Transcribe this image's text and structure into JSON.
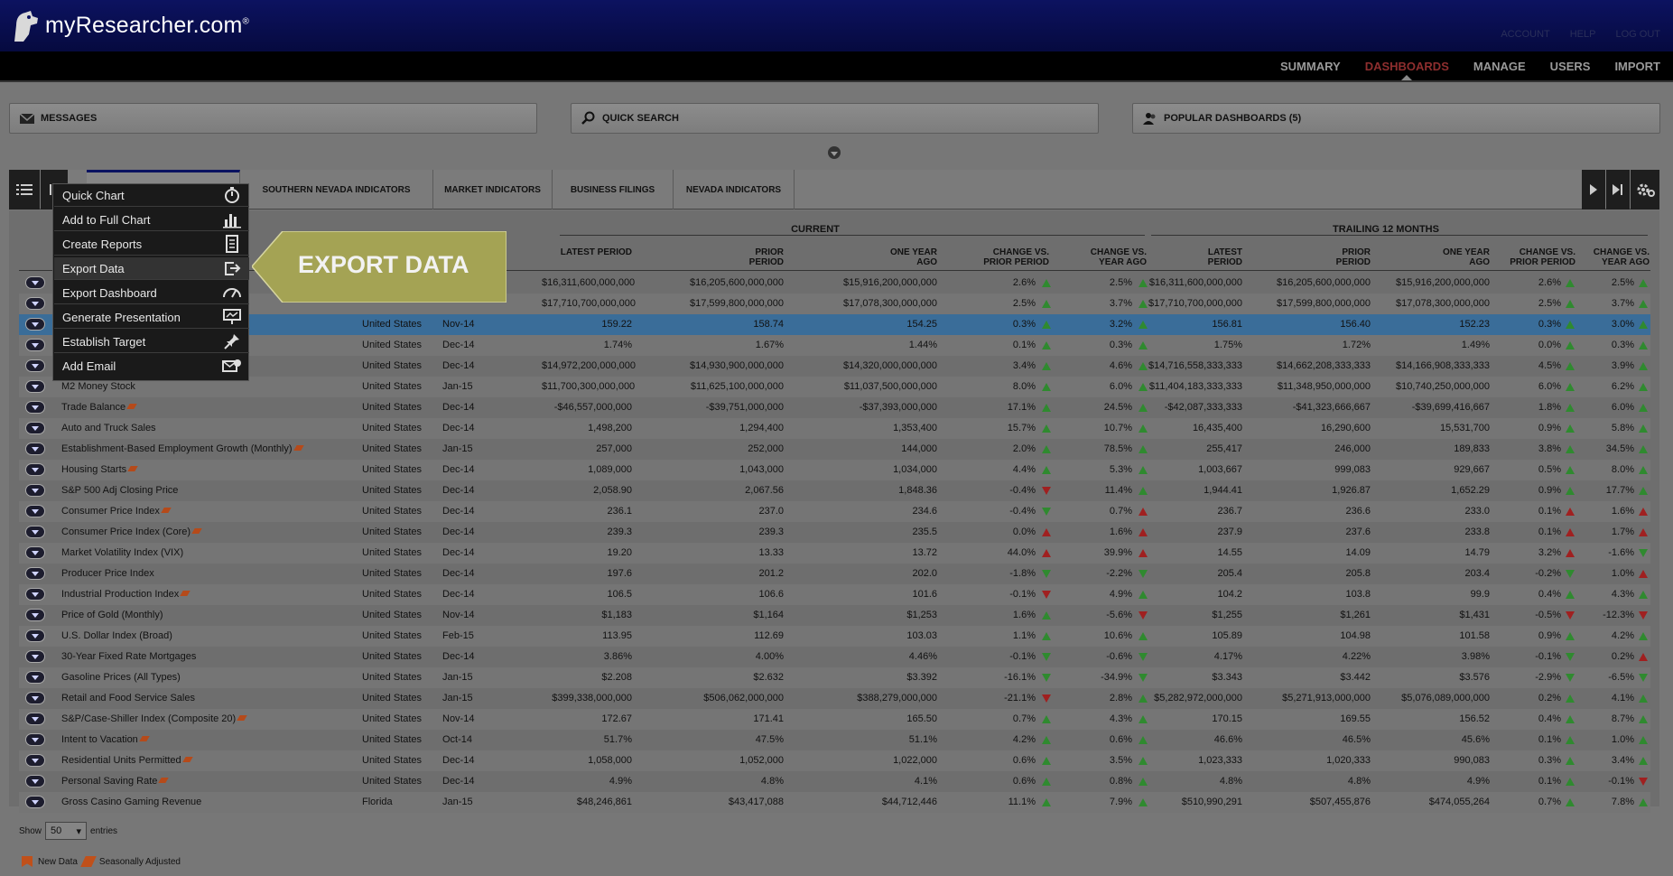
{
  "app": {
    "logo_text": "myResearcher.com",
    "logo_reg": "®",
    "account_links": [
      "ACCOUNT",
      "HELP",
      "LOG OUT"
    ]
  },
  "nav": {
    "items": [
      "SUMMARY",
      "DASHBOARDS",
      "MANAGE",
      "USERS",
      "IMPORT"
    ],
    "active": "DASHBOARDS"
  },
  "panels": {
    "messages": "MESSAGES",
    "quick_search": "QUICK SEARCH",
    "popular": "POPULAR DASHBOARDS (5)"
  },
  "tabs": [
    "SOUTHERN NEVADA INDICATORS",
    "MARKET INDICATORS",
    "BUSINESS FILINGS",
    "NEVADA INDICATORS"
  ],
  "table": {
    "group_current": "CURRENT",
    "group_trailing": "TRAILING 12 MONTHS",
    "headers": {
      "cur_latest": "LATEST PERIOD",
      "cur_prior": "PRIOR PERIOD",
      "cur_one_year": "ONE YEAR AGO",
      "cur_chg_prior": "CHANGE VS. PRIOR PERIOD",
      "cur_chg_year": "CHANGE VS. YEAR AGO",
      "t_latest": "LATEST PERIOD",
      "t_prior": "PRIOR PERIOD",
      "t_one_year": "ONE YEAR AGO",
      "t_chg_prior": "CHANGE VS. PRIOR PERIOD",
      "t_chg_year": "CHANGE VS. YEAR AGO"
    },
    "rows": [
      {
        "name": "",
        "sa": false,
        "region": "",
        "period": "",
        "latest": "$16,311,600,000,000",
        "prior": "$16,205,600,000,000",
        "year": "$15,916,200,000,000",
        "cp": "2.6%",
        "cpd": "up",
        "cy": "2.5%",
        "cyd": "up",
        "tl": "$16,311,600,000,000",
        "tp": "$16,205,600,000,000",
        "ty": "$15,916,200,000,000",
        "tcp": "2.6%",
        "tcpd": "up",
        "tcy": "2.5%",
        "tcyd": "up"
      },
      {
        "name": "",
        "sa": false,
        "region": "",
        "period": "",
        "latest": "$17,710,700,000,000",
        "prior": "$17,599,800,000,000",
        "year": "$17,078,300,000,000",
        "cp": "2.5%",
        "cpd": "up",
        "cy": "3.7%",
        "cyd": "up",
        "tl": "$17,710,700,000,000",
        "tp": "$17,599,800,000,000",
        "ty": "$17,078,300,000,000",
        "tcp": "2.5%",
        "tcpd": "up",
        "tcy": "3.7%",
        "tcyd": "up"
      },
      {
        "name": "",
        "sa": false,
        "region": "United States",
        "period": "Nov-14",
        "latest": "159.22",
        "prior": "158.74",
        "year": "154.25",
        "cp": "0.3%",
        "cpd": "up",
        "cy": "3.2%",
        "cyd": "up",
        "tl": "156.81",
        "tp": "156.40",
        "ty": "152.23",
        "tcp": "0.3%",
        "tcpd": "up",
        "tcy": "3.0%",
        "tcyd": "up",
        "selected": true
      },
      {
        "name": "",
        "sa": false,
        "region": "United States",
        "period": "Dec-14",
        "latest": "1.74%",
        "prior": "1.67%",
        "year": "1.44%",
        "cp": "0.1%",
        "cpd": "up",
        "cy": "0.3%",
        "cyd": "up",
        "tl": "1.75%",
        "tp": "1.72%",
        "ty": "1.49%",
        "tcp": "0.0%",
        "tcpd": "up",
        "tcy": "0.3%",
        "tcyd": "up"
      },
      {
        "name": "",
        "sa": false,
        "region": "United States",
        "period": "Dec-14",
        "latest": "$14,972,200,000,000",
        "prior": "$14,930,900,000,000",
        "year": "$14,320,000,000,000",
        "cp": "3.4%",
        "cpd": "up",
        "cy": "4.6%",
        "cyd": "up",
        "tl": "$14,716,558,333,333",
        "tp": "$14,662,208,333,333",
        "ty": "$14,166,908,333,333",
        "tcp": "4.5%",
        "tcpd": "up",
        "tcy": "3.9%",
        "tcyd": "up"
      },
      {
        "name": "M2 Money Stock",
        "sa": false,
        "region": "United States",
        "period": "Jan-15",
        "latest": "$11,700,300,000,000",
        "prior": "$11,625,100,000,000",
        "year": "$11,037,500,000,000",
        "cp": "8.0%",
        "cpd": "up",
        "cy": "6.0%",
        "cyd": "up",
        "tl": "$11,404,183,333,333",
        "tp": "$11,348,950,000,000",
        "ty": "$10,740,250,000,000",
        "tcp": "6.0%",
        "tcpd": "up",
        "tcy": "6.2%",
        "tcyd": "up"
      },
      {
        "name": "Trade Balance",
        "sa": true,
        "region": "United States",
        "period": "Dec-14",
        "latest": "-$46,557,000,000",
        "prior": "-$39,751,000,000",
        "year": "-$37,393,000,000",
        "cp": "17.1%",
        "cpd": "up",
        "cy": "24.5%",
        "cyd": "up",
        "tl": "-$42,087,333,333",
        "tp": "-$41,323,666,667",
        "ty": "-$39,699,416,667",
        "tcp": "1.8%",
        "tcpd": "up",
        "tcy": "6.0%",
        "tcyd": "up"
      },
      {
        "name": "Auto and Truck Sales",
        "sa": false,
        "region": "United States",
        "period": "Dec-14",
        "latest": "1,498,200",
        "prior": "1,294,400",
        "year": "1,353,400",
        "cp": "15.7%",
        "cpd": "up",
        "cy": "10.7%",
        "cyd": "up",
        "tl": "16,435,400",
        "tp": "16,290,600",
        "ty": "15,531,700",
        "tcp": "0.9%",
        "tcpd": "up",
        "tcy": "5.8%",
        "tcyd": "up"
      },
      {
        "name": "Establishment-Based Employment Growth (Monthly)",
        "sa": true,
        "region": "United States",
        "period": "Jan-15",
        "latest": "257,000",
        "prior": "252,000",
        "year": "144,000",
        "cp": "2.0%",
        "cpd": "up",
        "cy": "78.5%",
        "cyd": "up",
        "tl": "255,417",
        "tp": "246,000",
        "ty": "189,833",
        "tcp": "3.8%",
        "tcpd": "up",
        "tcy": "34.5%",
        "tcyd": "up"
      },
      {
        "name": "Housing Starts",
        "sa": true,
        "region": "United States",
        "period": "Dec-14",
        "latest": "1,089,000",
        "prior": "1,043,000",
        "year": "1,034,000",
        "cp": "4.4%",
        "cpd": "up",
        "cy": "5.3%",
        "cyd": "up",
        "tl": "1,003,667",
        "tp": "999,083",
        "ty": "929,667",
        "tcp": "0.5%",
        "tcpd": "up",
        "tcy": "8.0%",
        "tcyd": "up"
      },
      {
        "name": "S&P 500 Adj Closing Price",
        "sa": false,
        "region": "United States",
        "period": "Dec-14",
        "latest": "2,058.90",
        "prior": "2,067.56",
        "year": "1,848.36",
        "cp": "-0.4%",
        "cpd": "down",
        "cy": "11.4%",
        "cyd": "up",
        "tl": "1,944.41",
        "tp": "1,926.87",
        "ty": "1,652.29",
        "tcp": "0.9%",
        "tcpd": "up",
        "tcy": "17.7%",
        "tcyd": "up"
      },
      {
        "name": "Consumer Price Index",
        "sa": true,
        "region": "United States",
        "period": "Dec-14",
        "latest": "236.1",
        "prior": "237.0",
        "year": "234.6",
        "cp": "-0.4%",
        "cpd": "downgreen",
        "cy": "0.7%",
        "cyd": "upred",
        "tl": "236.7",
        "tp": "236.6",
        "ty": "233.0",
        "tcp": "0.1%",
        "tcpd": "upred",
        "tcy": "1.6%",
        "tcyd": "upred"
      },
      {
        "name": "Consumer Price Index (Core)",
        "sa": true,
        "region": "United States",
        "period": "Dec-14",
        "latest": "239.3",
        "prior": "239.3",
        "year": "235.5",
        "cp": "0.0%",
        "cpd": "upred",
        "cy": "1.6%",
        "cyd": "upred",
        "tl": "237.9",
        "tp": "237.6",
        "ty": "233.8",
        "tcp": "0.1%",
        "tcpd": "upred",
        "tcy": "1.7%",
        "tcyd": "upred"
      },
      {
        "name": "Market Volatility Index (VIX)",
        "sa": false,
        "region": "United States",
        "period": "Dec-14",
        "latest": "19.20",
        "prior": "13.33",
        "year": "13.72",
        "cp": "44.0%",
        "cpd": "upred",
        "cy": "39.9%",
        "cyd": "upred",
        "tl": "14.55",
        "tp": "14.09",
        "ty": "14.79",
        "tcp": "3.2%",
        "tcpd": "upred",
        "tcy": "-1.6%",
        "tcyd": "downgreen"
      },
      {
        "name": "Producer Price Index",
        "sa": false,
        "region": "United States",
        "period": "Dec-14",
        "latest": "197.6",
        "prior": "201.2",
        "year": "202.0",
        "cp": "-1.8%",
        "cpd": "downgreen",
        "cy": "-2.2%",
        "cyd": "downgreen",
        "tl": "205.4",
        "tp": "205.8",
        "ty": "203.4",
        "tcp": "-0.2%",
        "tcpd": "downgreen",
        "tcy": "1.0%",
        "tcyd": "upred"
      },
      {
        "name": "Industrial Production Index",
        "sa": true,
        "region": "United States",
        "period": "Dec-14",
        "latest": "106.5",
        "prior": "106.6",
        "year": "101.6",
        "cp": "-0.1%",
        "cpd": "down",
        "cy": "4.9%",
        "cyd": "up",
        "tl": "104.2",
        "tp": "103.8",
        "ty": "99.9",
        "tcp": "0.4%",
        "tcpd": "up",
        "tcy": "4.3%",
        "tcyd": "up"
      },
      {
        "name": "Price of Gold (Monthly)",
        "sa": false,
        "region": "United States",
        "period": "Nov-14",
        "latest": "$1,183",
        "prior": "$1,164",
        "year": "$1,253",
        "cp": "1.6%",
        "cpd": "up",
        "cy": "-5.6%",
        "cyd": "down",
        "tl": "$1,255",
        "tp": "$1,261",
        "ty": "$1,431",
        "tcp": "-0.5%",
        "tcpd": "down",
        "tcy": "-12.3%",
        "tcyd": "down"
      },
      {
        "name": "U.S. Dollar Index (Broad)",
        "sa": false,
        "region": "United States",
        "period": "Feb-15",
        "latest": "113.95",
        "prior": "112.69",
        "year": "103.03",
        "cp": "1.1%",
        "cpd": "up",
        "cy": "10.6%",
        "cyd": "up",
        "tl": "105.89",
        "tp": "104.98",
        "ty": "101.58",
        "tcp": "0.9%",
        "tcpd": "up",
        "tcy": "4.2%",
        "tcyd": "up"
      },
      {
        "name": "30-Year Fixed Rate Mortgages",
        "sa": false,
        "region": "United States",
        "period": "Dec-14",
        "latest": "3.86%",
        "prior": "4.00%",
        "year": "4.46%",
        "cp": "-0.1%",
        "cpd": "downgreen",
        "cy": "-0.6%",
        "cyd": "downgreen",
        "tl": "4.17%",
        "tp": "4.22%",
        "ty": "3.98%",
        "tcp": "-0.1%",
        "tcpd": "downgreen",
        "tcy": "0.2%",
        "tcyd": "upred"
      },
      {
        "name": "Gasoline Prices (All Types)",
        "sa": false,
        "region": "United States",
        "period": "Jan-15",
        "latest": "$2.208",
        "prior": "$2.632",
        "year": "$3.392",
        "cp": "-16.1%",
        "cpd": "downgreen",
        "cy": "-34.9%",
        "cyd": "downgreen",
        "tl": "$3.343",
        "tp": "$3.442",
        "ty": "$3.576",
        "tcp": "-2.9%",
        "tcpd": "downgreen",
        "tcy": "-6.5%",
        "tcyd": "downgreen"
      },
      {
        "name": "Retail and Food Service Sales",
        "sa": false,
        "region": "United States",
        "period": "Jan-15",
        "latest": "$399,338,000,000",
        "prior": "$506,062,000,000",
        "year": "$388,279,000,000",
        "cp": "-21.1%",
        "cpd": "down",
        "cy": "2.8%",
        "cyd": "up",
        "tl": "$5,282,972,000,000",
        "tp": "$5,271,913,000,000",
        "ty": "$5,076,089,000,000",
        "tcp": "0.2%",
        "tcpd": "up",
        "tcy": "4.1%",
        "tcyd": "up"
      },
      {
        "name": "S&P/Case-Shiller Index (Composite 20)",
        "sa": true,
        "region": "United States",
        "period": "Nov-14",
        "latest": "172.67",
        "prior": "171.41",
        "year": "165.50",
        "cp": "0.7%",
        "cpd": "up",
        "cy": "4.3%",
        "cyd": "up",
        "tl": "170.15",
        "tp": "169.55",
        "ty": "156.52",
        "tcp": "0.4%",
        "tcpd": "up",
        "tcy": "8.7%",
        "tcyd": "up"
      },
      {
        "name": "Intent to Vacation",
        "sa": true,
        "region": "United States",
        "period": "Oct-14",
        "latest": "51.7%",
        "prior": "47.5%",
        "year": "51.1%",
        "cp": "4.2%",
        "cpd": "up",
        "cy": "0.6%",
        "cyd": "up",
        "tl": "46.6%",
        "tp": "46.5%",
        "ty": "45.6%",
        "tcp": "0.1%",
        "tcpd": "up",
        "tcy": "1.0%",
        "tcyd": "up"
      },
      {
        "name": "Residential Units Permitted",
        "sa": true,
        "region": "United States",
        "period": "Dec-14",
        "latest": "1,058,000",
        "prior": "1,052,000",
        "year": "1,022,000",
        "cp": "0.6%",
        "cpd": "up",
        "cy": "3.5%",
        "cyd": "up",
        "tl": "1,023,333",
        "tp": "1,020,333",
        "ty": "990,083",
        "tcp": "0.3%",
        "tcpd": "up",
        "tcy": "3.4%",
        "tcyd": "up"
      },
      {
        "name": "Personal Saving Rate",
        "sa": true,
        "region": "United States",
        "period": "Dec-14",
        "latest": "4.9%",
        "prior": "4.8%",
        "year": "4.1%",
        "cp": "0.6%",
        "cpd": "up",
        "cy": "0.8%",
        "cyd": "up",
        "tl": "4.8%",
        "tp": "4.8%",
        "ty": "4.9%",
        "tcp": "0.1%",
        "tcpd": "up",
        "tcy": "-0.1%",
        "tcyd": "down"
      },
      {
        "name": "Gross Casino Gaming Revenue",
        "sa": false,
        "region": "Florida",
        "period": "Jan-15",
        "latest": "$48,246,861",
        "prior": "$43,417,088",
        "year": "$44,712,446",
        "cp": "11.1%",
        "cpd": "up",
        "cy": "7.9%",
        "cyd": "up",
        "tl": "$510,990,291",
        "tp": "$507,455,876",
        "ty": "$474,055,264",
        "tcp": "0.7%",
        "tcpd": "up",
        "tcy": "7.8%",
        "tcyd": "up"
      }
    ]
  },
  "footer": {
    "show_label": "Show",
    "show_value": "50",
    "entries_label": "entries",
    "legend_new": "New Data",
    "legend_sa": "Seasonally Adjusted"
  },
  "menu": {
    "items": [
      {
        "label": "Quick Chart",
        "icon": "stopwatch-icon"
      },
      {
        "label": "Add to Full Chart",
        "icon": "bar-chart-icon"
      },
      {
        "label": "Create Reports",
        "icon": "document-icon"
      },
      {
        "label": "Export Data",
        "icon": "export-icon"
      },
      {
        "label": "Export Dashboard",
        "icon": "gauge-icon"
      },
      {
        "label": "Generate Presentation",
        "icon": "presentation-icon"
      },
      {
        "label": "Establish Target",
        "icon": "pin-icon"
      },
      {
        "label": "Add Email",
        "icon": "email-icon"
      }
    ]
  },
  "callout": {
    "text": "EXPORT DATA"
  },
  "colors": {
    "header_bg": "#0c1260",
    "active_nav": "#8e2e2e",
    "selected_row": "#3a6d99",
    "callout": "#a4a354",
    "up": "#2f8a2f",
    "down": "#a02020"
  }
}
